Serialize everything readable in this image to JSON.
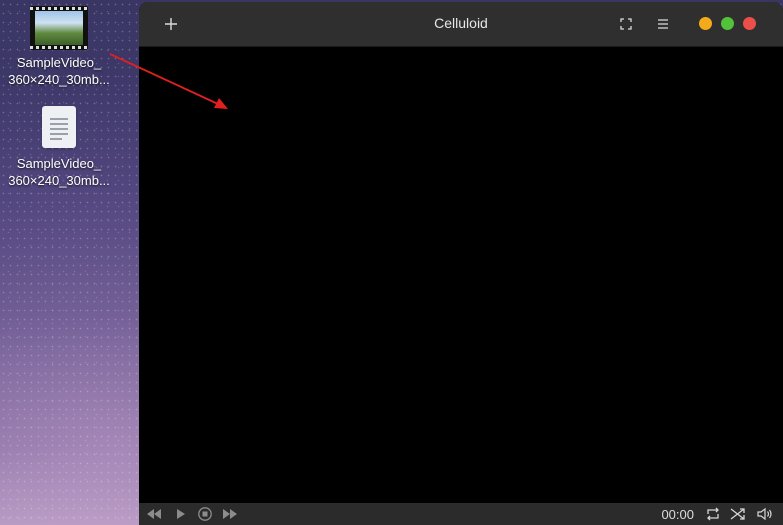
{
  "desktop": {
    "icons": [
      {
        "name": "SampleVideo_360x240_30mb",
        "label_line1": "SampleVideo_",
        "label_line2": "360×240_30mb...",
        "type": "video-thumbnail-icon"
      },
      {
        "name": "SampleVideo_360x240_30mb",
        "label_line1": "SampleVideo_",
        "label_line2": "360×240_30mb...",
        "type": "text-document-icon"
      }
    ]
  },
  "window": {
    "title": "Celluloid",
    "header_buttons": {
      "add_icon": "plus-icon",
      "fullscreen_icon": "fullscreen-icon",
      "menu_icon": "hamburger-menu-icon"
    },
    "window_controls": {
      "minimize_color": "#f5aa1b",
      "maximize_color": "#52c23a",
      "close_color": "#ec4e4a"
    },
    "controls": {
      "time": "00:00",
      "icons": [
        "rewind-icon",
        "play-icon",
        "stop-icon",
        "fast-forward-icon",
        "loop-icon",
        "shuffle-icon",
        "volume-icon"
      ]
    }
  },
  "annotation": {
    "arrow_color": "#e01f1f"
  }
}
